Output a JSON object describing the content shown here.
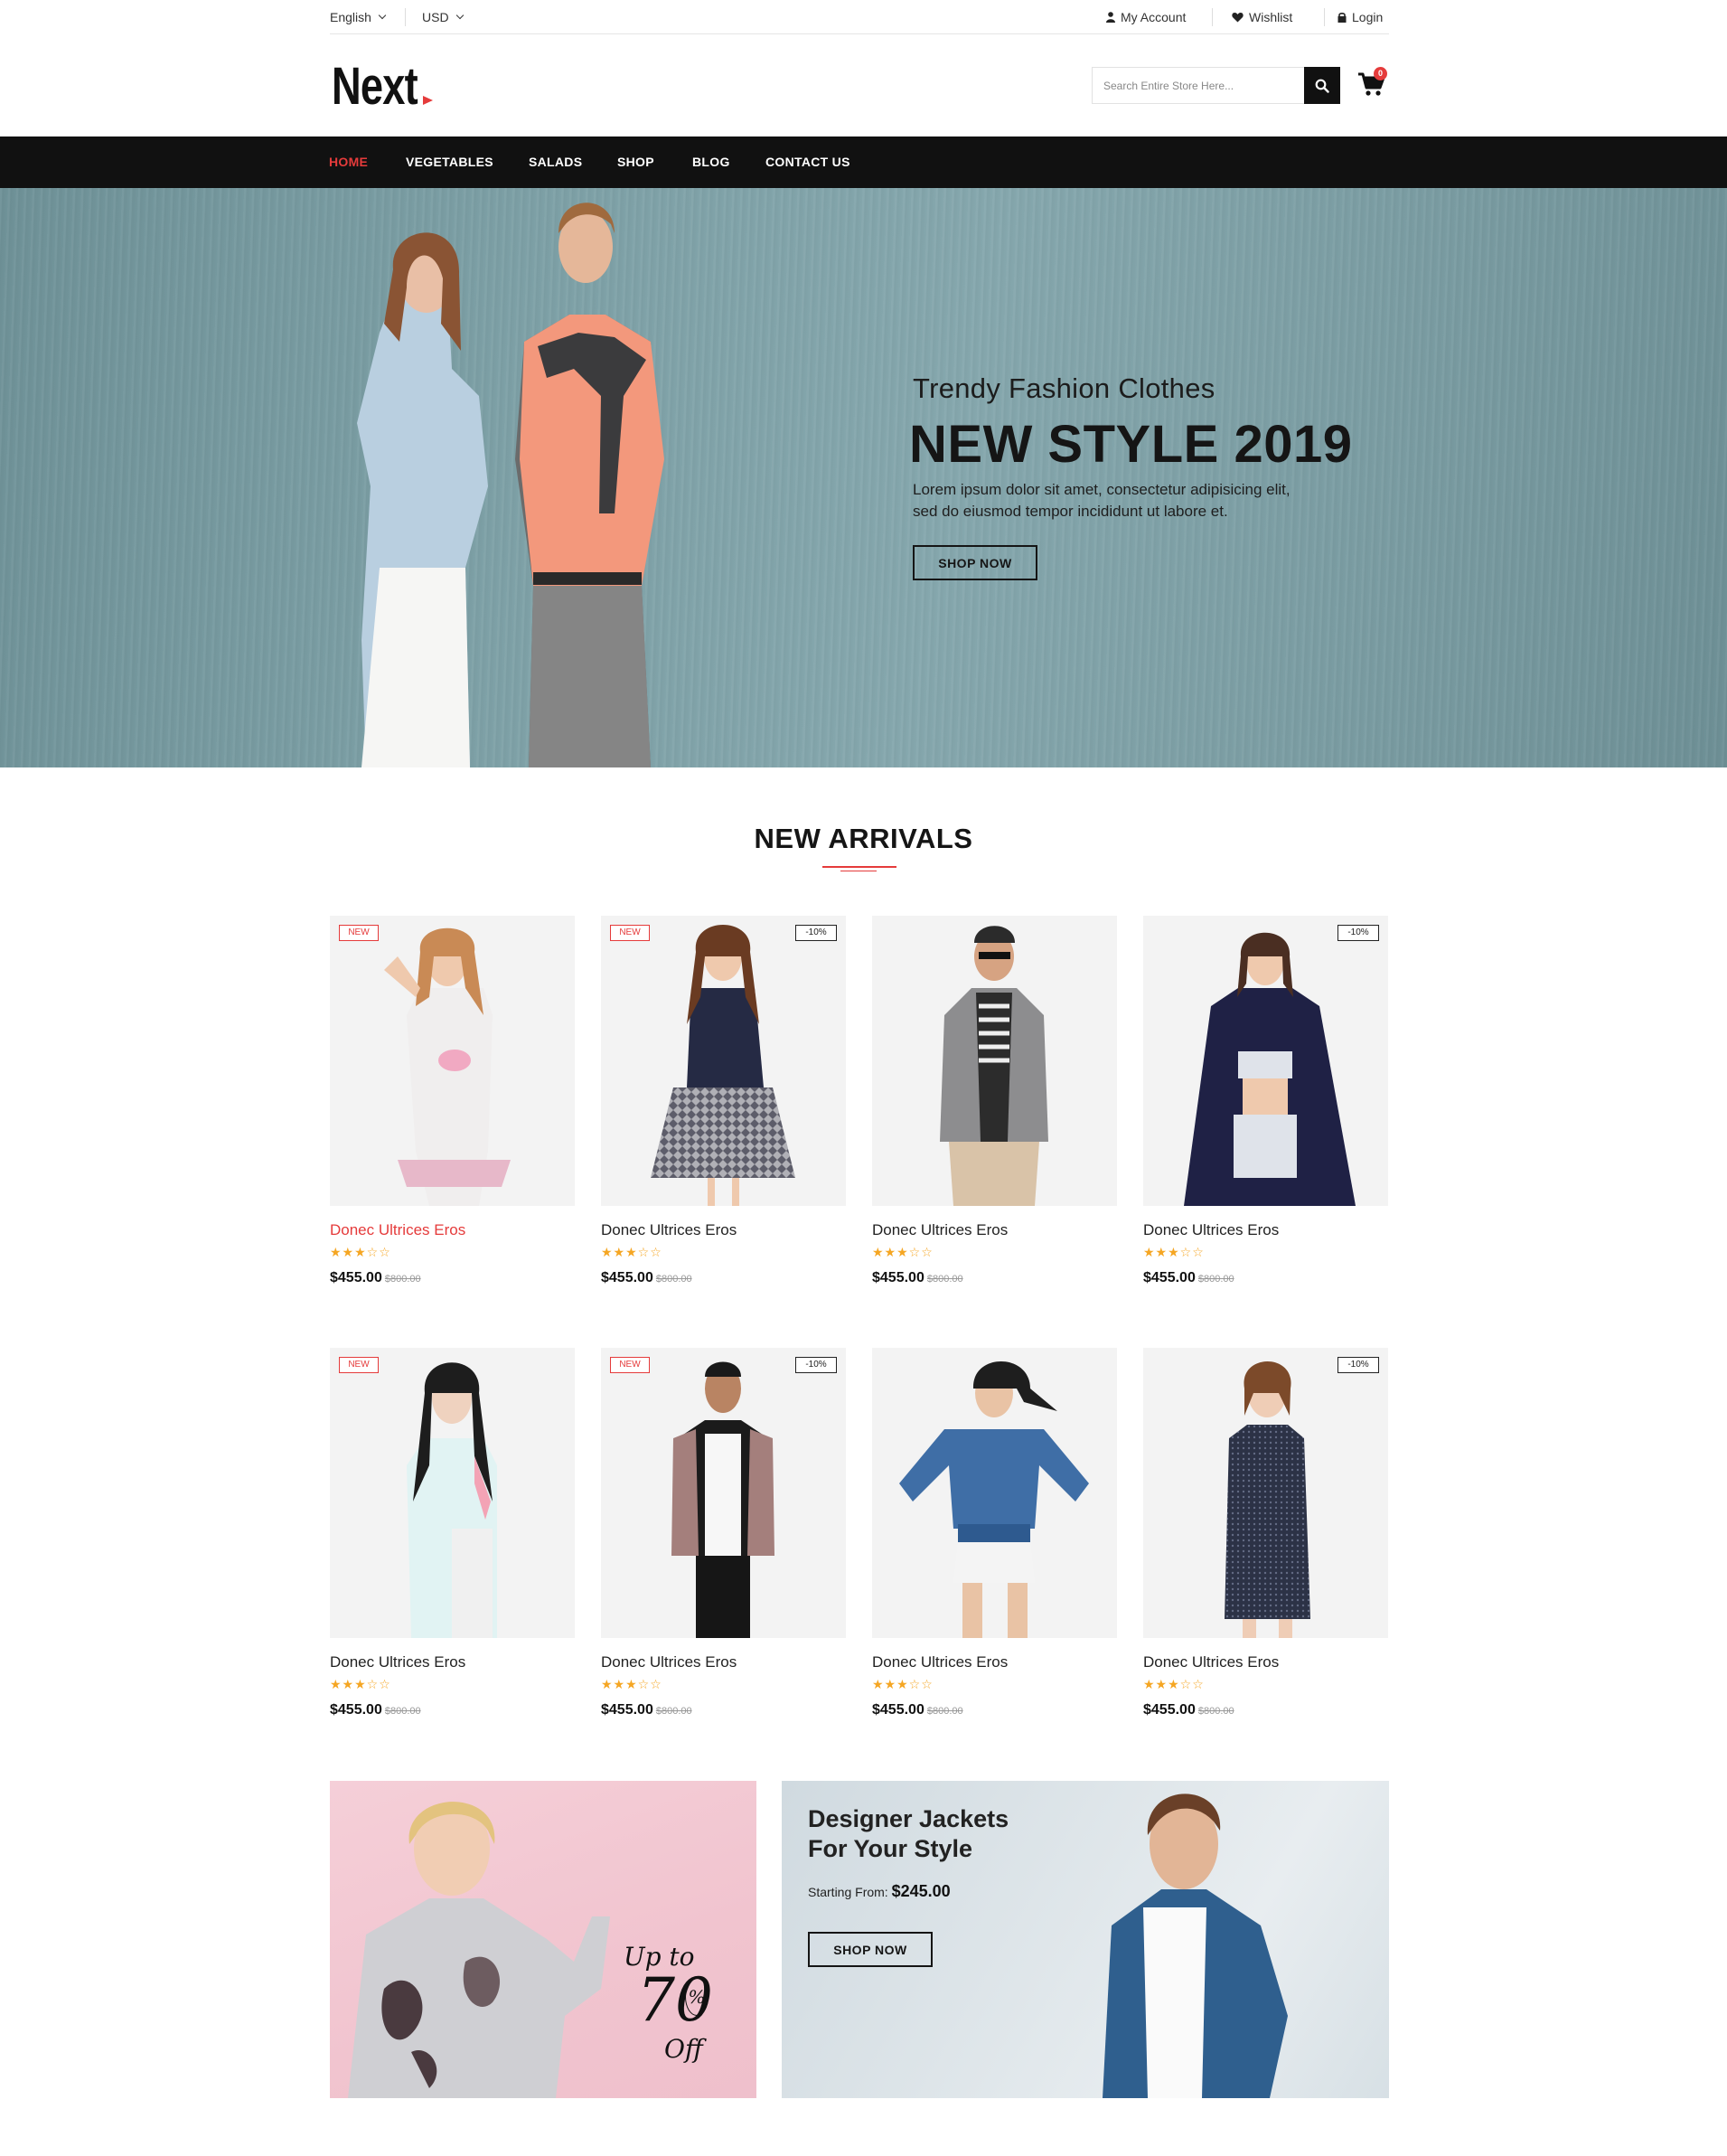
{
  "topbar": {
    "language": "English",
    "currency": "USD",
    "account": "My Account",
    "wishlist": "Wishlist",
    "login": "Login"
  },
  "header": {
    "logo": "Next",
    "search_placeholder": "Search Entire Store Here...",
    "cart_count": "0"
  },
  "nav": {
    "items": [
      "HOME",
      "VEGETABLES",
      "SALADS",
      "SHOP",
      "BLOG",
      "CONTACT US"
    ],
    "active": "HOME"
  },
  "hero": {
    "subtitle": "Trendy Fashion Clothes",
    "title": "NEW STYLE 2019",
    "description": "Lorem ipsum dolor sit amet, consectetur adipisicing elit, sed do eiusmod tempor incididunt ut labore et.",
    "button": "SHOP NOW"
  },
  "new_arrivals": {
    "title": "NEW ARRIVALS",
    "products": [
      {
        "name": "Donec Ultrices Eros",
        "price": "$455.00",
        "old_price": "$800.00",
        "rating": 3,
        "badge_new": "NEW",
        "badge_discount": ""
      },
      {
        "name": "Donec Ultrices Eros",
        "price": "$455.00",
        "old_price": "$800.00",
        "rating": 3,
        "badge_new": "NEW",
        "badge_discount": "-10%"
      },
      {
        "name": "Donec Ultrices Eros",
        "price": "$455.00",
        "old_price": "$800.00",
        "rating": 3,
        "badge_new": "",
        "badge_discount": ""
      },
      {
        "name": "Donec Ultrices Eros",
        "price": "$455.00",
        "old_price": "$800.00",
        "rating": 3,
        "badge_new": "",
        "badge_discount": "-10%"
      },
      {
        "name": "Donec Ultrices Eros",
        "price": "$455.00",
        "old_price": "$800.00",
        "rating": 3,
        "badge_new": "NEW",
        "badge_discount": ""
      },
      {
        "name": "Donec Ultrices Eros",
        "price": "$455.00",
        "old_price": "$800.00",
        "rating": 3,
        "badge_new": "NEW",
        "badge_discount": "-10%"
      },
      {
        "name": "Donec Ultrices Eros",
        "price": "$455.00",
        "old_price": "$800.00",
        "rating": 3,
        "badge_new": "",
        "badge_discount": ""
      },
      {
        "name": "Donec Ultrices Eros",
        "price": "$455.00",
        "old_price": "$800.00",
        "rating": 3,
        "badge_new": "",
        "badge_discount": "-10%"
      }
    ]
  },
  "banner_left": {
    "promo_line1": "Up to",
    "promo_number": "70",
    "promo_percent": "%",
    "promo_line2": "Off"
  },
  "banner_right": {
    "title": "Designer Jackets For Your Style",
    "starting_label": "Starting From:",
    "starting_price": "$245.00",
    "button": "SHOP NOW"
  },
  "colors": {
    "accent": "#e53b3b",
    "nav_bg": "#111111",
    "star": "#f5a623"
  }
}
